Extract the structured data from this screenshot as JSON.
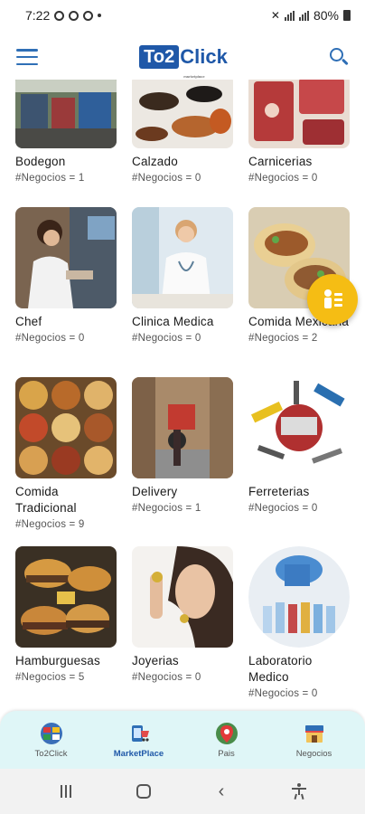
{
  "status": {
    "time": "7:22",
    "battery": "80%"
  },
  "header": {
    "logo_prefix": "To2",
    "logo_suffix": "Click",
    "logo_tagline": "marketplace",
    "menu_icon": "hamburger-menu-icon",
    "search_icon": "search-icon"
  },
  "categories": [
    {
      "name": "Bodegon",
      "count": "#Negocios = 1"
    },
    {
      "name": "Calzado",
      "count": "#Negocios = 0"
    },
    {
      "name": "Carnicerias",
      "count": "#Negocios = 0"
    },
    {
      "name": "Chef",
      "count": "#Negocios = 0"
    },
    {
      "name": "Clinica Medica",
      "count": "#Negocios = 0"
    },
    {
      "name": "Comida Mexicana",
      "count": "#Negocios = 2"
    },
    {
      "name": "Comida Tradicional",
      "count": "#Negocios = 9"
    },
    {
      "name": "Delivery",
      "count": "#Negocios = 1"
    },
    {
      "name": "Ferreterias",
      "count": "#Negocios = 0"
    },
    {
      "name": "Hamburguesas",
      "count": "#Negocios = 5"
    },
    {
      "name": "Joyerias",
      "count": "#Negocios = 0"
    },
    {
      "name": "Laboratorio Medico",
      "count": "#Negocios = 0"
    }
  ],
  "fab": {
    "icon": "person-chat-icon",
    "color": "#f5bd14"
  },
  "bottom_nav": [
    {
      "label": "To2Click",
      "icon": "globe-flags-icon"
    },
    {
      "label": "MarketPlace",
      "icon": "marketplace-icon",
      "active": true
    },
    {
      "label": "Pais",
      "icon": "location-pin-icon"
    },
    {
      "label": "Negocios",
      "icon": "storefront-icon"
    }
  ],
  "colors": {
    "brand": "#1f58a8",
    "accent": "#f5bd14",
    "nav_bg": "#dff6f7"
  }
}
